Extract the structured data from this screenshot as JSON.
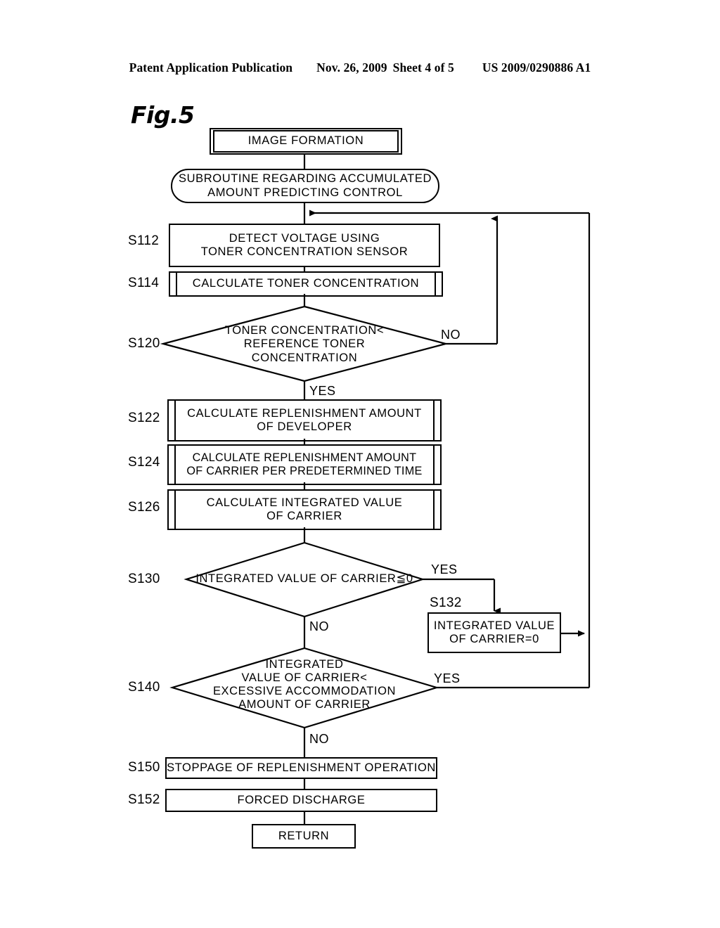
{
  "header": {
    "publication": "Patent Application Publication",
    "date": "Nov. 26, 2009",
    "sheet": "Sheet 4 of 5",
    "doc_number": "US 2009/0290886 A1"
  },
  "figure": {
    "label": "Fig.5"
  },
  "nodes": {
    "image_formation": {
      "step": "",
      "text": "IMAGE FORMATION",
      "shape": "double-box"
    },
    "subroutine": {
      "step": "",
      "text": "SUBROUTINE REGARDING ACCUMULATED AMOUNT PREDICTING CONTROL",
      "shape": "rounded-terminal"
    },
    "s112": {
      "step": "S112",
      "text": "DETECT VOLTAGE USING TONER CONCENTRATION SENSOR",
      "shape": "process"
    },
    "s114": {
      "step": "S114",
      "text": "CALCULATE TONER CONCENTRATION",
      "shape": "subroutine"
    },
    "s120": {
      "step": "S120",
      "text": "TONER CONCENTRATION< REFERENCE TONER CONCENTRATION",
      "shape": "decision",
      "yes": "YES",
      "no": "NO"
    },
    "s122": {
      "step": "S122",
      "text": "CALCULATE REPLENISHMENT AMOUNT OF DEVELOPER",
      "shape": "subroutine"
    },
    "s124": {
      "step": "S124",
      "text": "CALCULATE REPLENISHMENT AMOUNT OF CARRIER PER PREDETERMINED TIME",
      "shape": "subroutine"
    },
    "s126": {
      "step": "S126",
      "text": "CALCULATE INTEGRATED VALUE OF CARRIER",
      "shape": "subroutine"
    },
    "s130": {
      "step": "S130",
      "text": "INTEGRATED VALUE OF CARRIER≦0",
      "shape": "decision",
      "yes": "YES",
      "no": "NO"
    },
    "s132": {
      "step": "S132",
      "text": "INTEGRATED VALUE OF CARRIER=0",
      "shape": "process"
    },
    "s140": {
      "step": "S140",
      "text": "INTEGRATED VALUE OF CARRIER< EXCESSIVE ACCOMMODATION AMOUNT OF CARRIER",
      "shape": "decision",
      "yes": "YES",
      "no": "NO"
    },
    "s150": {
      "step": "S150",
      "text": "STOPPAGE OF REPLENISHMENT OPERATION",
      "shape": "process"
    },
    "s152": {
      "step": "S152",
      "text": "FORCED DISCHARGE",
      "shape": "process"
    },
    "return": {
      "step": "",
      "text": "RETURN",
      "shape": "process"
    }
  },
  "node_lines": {
    "s112": [
      "DETECT VOLTAGE USING",
      "TONER CONCENTRATION SENSOR"
    ],
    "s120": [
      "TONER CONCENTRATION<",
      "REFERENCE TONER",
      "CONCENTRATION"
    ],
    "s122": [
      "CALCULATE REPLENISHMENT AMOUNT",
      "OF DEVELOPER"
    ],
    "s124": [
      "CALCULATE REPLENISHMENT AMOUNT",
      "OF CARRIER PER PREDETERMINED TIME"
    ],
    "s126": [
      "CALCULATE INTEGRATED VALUE",
      "OF CARRIER"
    ],
    "s132": [
      "INTEGRATED VALUE",
      "OF CARRIER=0"
    ],
    "s140": [
      "INTEGRATED",
      "VALUE OF CARRIER<",
      "EXCESSIVE ACCOMMODATION",
      "AMOUNT OF CARRIER"
    ],
    "subroutine": [
      "SUBROUTINE REGARDING ACCUMULATED",
      "AMOUNT PREDICTING CONTROL"
    ]
  },
  "colors": {
    "ink": "#000000",
    "paper": "#ffffff"
  }
}
